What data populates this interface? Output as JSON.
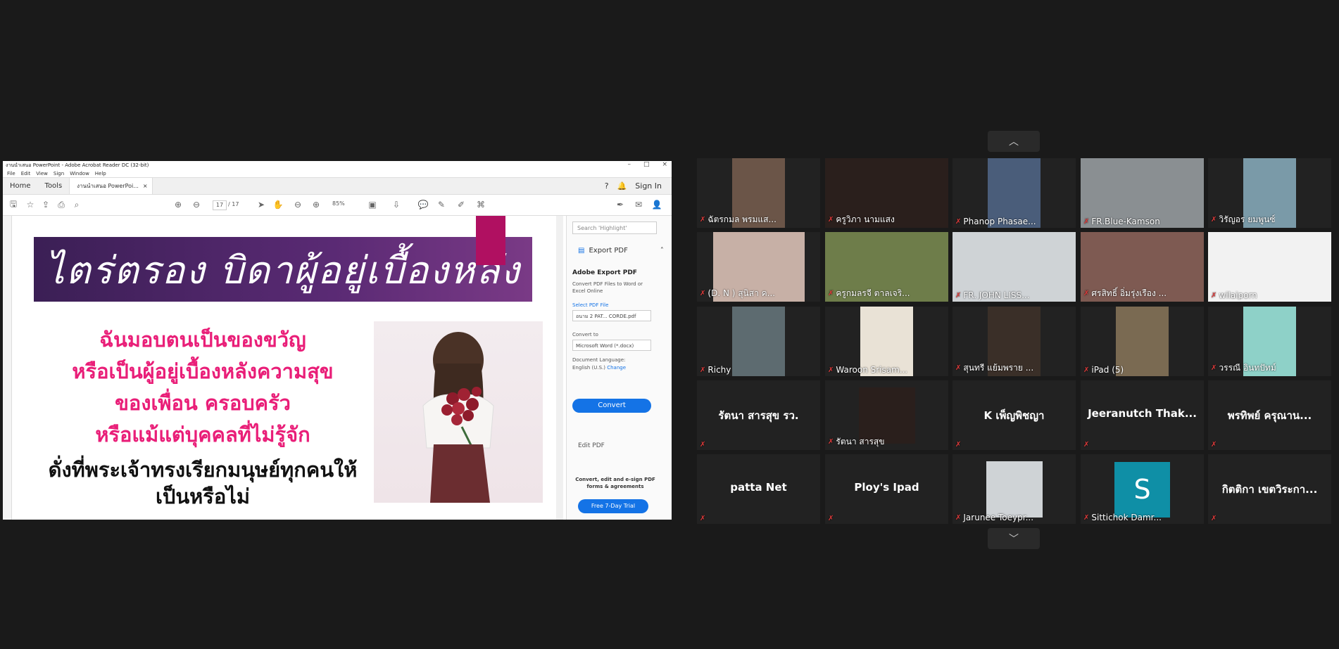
{
  "acrobat": {
    "window_title": "งานนำเสนอ PowerPoint - Adobe Acrobat Reader DC (32-bit)",
    "menu": [
      "File",
      "Edit",
      "View",
      "Sign",
      "Window",
      "Help"
    ],
    "tabs": {
      "home": "Home",
      "tools": "Tools",
      "doc": "งานนำเสนอ PowerPoi...",
      "doc_close": "×"
    },
    "sign_in": "Sign In",
    "page_current": "17",
    "page_total": "/ 17",
    "zoom": "85%",
    "slide": {
      "title": "ไตร่ตรอง บิดาผู้อยู่เบื้องหลัง",
      "pink_lines": [
        "ฉันมอบตนเป็นของขวัญ",
        "หรือเป็นผู้อยู่เบื้องหลังความสุข",
        "ของเพื่อน ครอบครัว",
        "หรือแม้แต่บุคคลที่ไม่รู้จัก"
      ],
      "black_lines": [
        "ดั่งที่พระเจ้าทรงเรียกมนุษย์ทุกคนให้",
        "เป็นหรือไม่"
      ]
    },
    "right_pane": {
      "search_placeholder": "Search 'Highlight'",
      "export_pdf": "Export PDF",
      "adobe_export_pdf": "Adobe Export PDF",
      "export_desc": "Convert PDF Files to Word or Excel Online",
      "select_pdf_file": "Select PDF File",
      "file_name": "อนาม 2 PAT... CORDE.pdf",
      "convert_to": "Convert to",
      "convert_format": "Microsoft Word (*.docx)",
      "doc_language": "Document Language:",
      "language": "English (U.S.)",
      "change": "Change",
      "convert_btn": "Convert",
      "edit_pdf": "Edit PDF",
      "promo": "Convert, edit and e-sign PDF forms & agreements",
      "trial_btn": "Free 7-Day Trial"
    },
    "colors": {
      "pink_text": "#e91e78",
      "accent_blue": "#1473e6",
      "banner": "#4a2466"
    }
  },
  "gallery": {
    "up_icon": "chevron-up-icon",
    "down_icon": "chevron-down-icon",
    "participants": [
      {
        "name": "ฉัตรกมล พรมแส...",
        "video": true
      },
      {
        "name": "ครูวิภา นามแสง",
        "video": true
      },
      {
        "name": "Phanop Phasae...",
        "video": true
      },
      {
        "name": "FR.Blue-Kamson",
        "video": true
      },
      {
        "name": "วิรัญอร ยมพูนซ์",
        "video": true
      },
      {
        "name": "(D. N ) สุนิสา ค...",
        "video": true
      },
      {
        "name": "ครูกมลรจี ตาลเจริ...",
        "video": true
      },
      {
        "name": "FR. JOHN LISS...",
        "video": true
      },
      {
        "name": "ศรสิทธิ์ อิ่มรุ่งเรือง ...",
        "video": true
      },
      {
        "name": "wilaiporn",
        "video": true
      },
      {
        "name": "Richy",
        "video": true
      },
      {
        "name": "Waroon Srisam...",
        "video": true
      },
      {
        "name": "สุนทรี แย้มพราย ...",
        "video": true
      },
      {
        "name": "iPad (5)",
        "video": true
      },
      {
        "name": "วรรณี อินทปัทม์",
        "video": true
      },
      {
        "name": "รัตนา สารสุข รว.",
        "video": false
      },
      {
        "name": "รัตนา สารสุข",
        "video": true
      },
      {
        "name": "K เพ็ญพิชญา",
        "video": false
      },
      {
        "name": "Jeeranutch Thak...",
        "video": false
      },
      {
        "name": "พรทิพย์ ครุณาน...",
        "video": false
      },
      {
        "name": "patta Net",
        "video": false
      },
      {
        "name": "Ploy's Ipad",
        "video": false
      },
      {
        "name": "Jarunee Toeypr...",
        "video": true
      },
      {
        "name": "Sittichok Damr...",
        "video": false,
        "avatar": "S"
      },
      {
        "name": "กิตติกา เขตวิระกา...",
        "video": false
      }
    ]
  }
}
